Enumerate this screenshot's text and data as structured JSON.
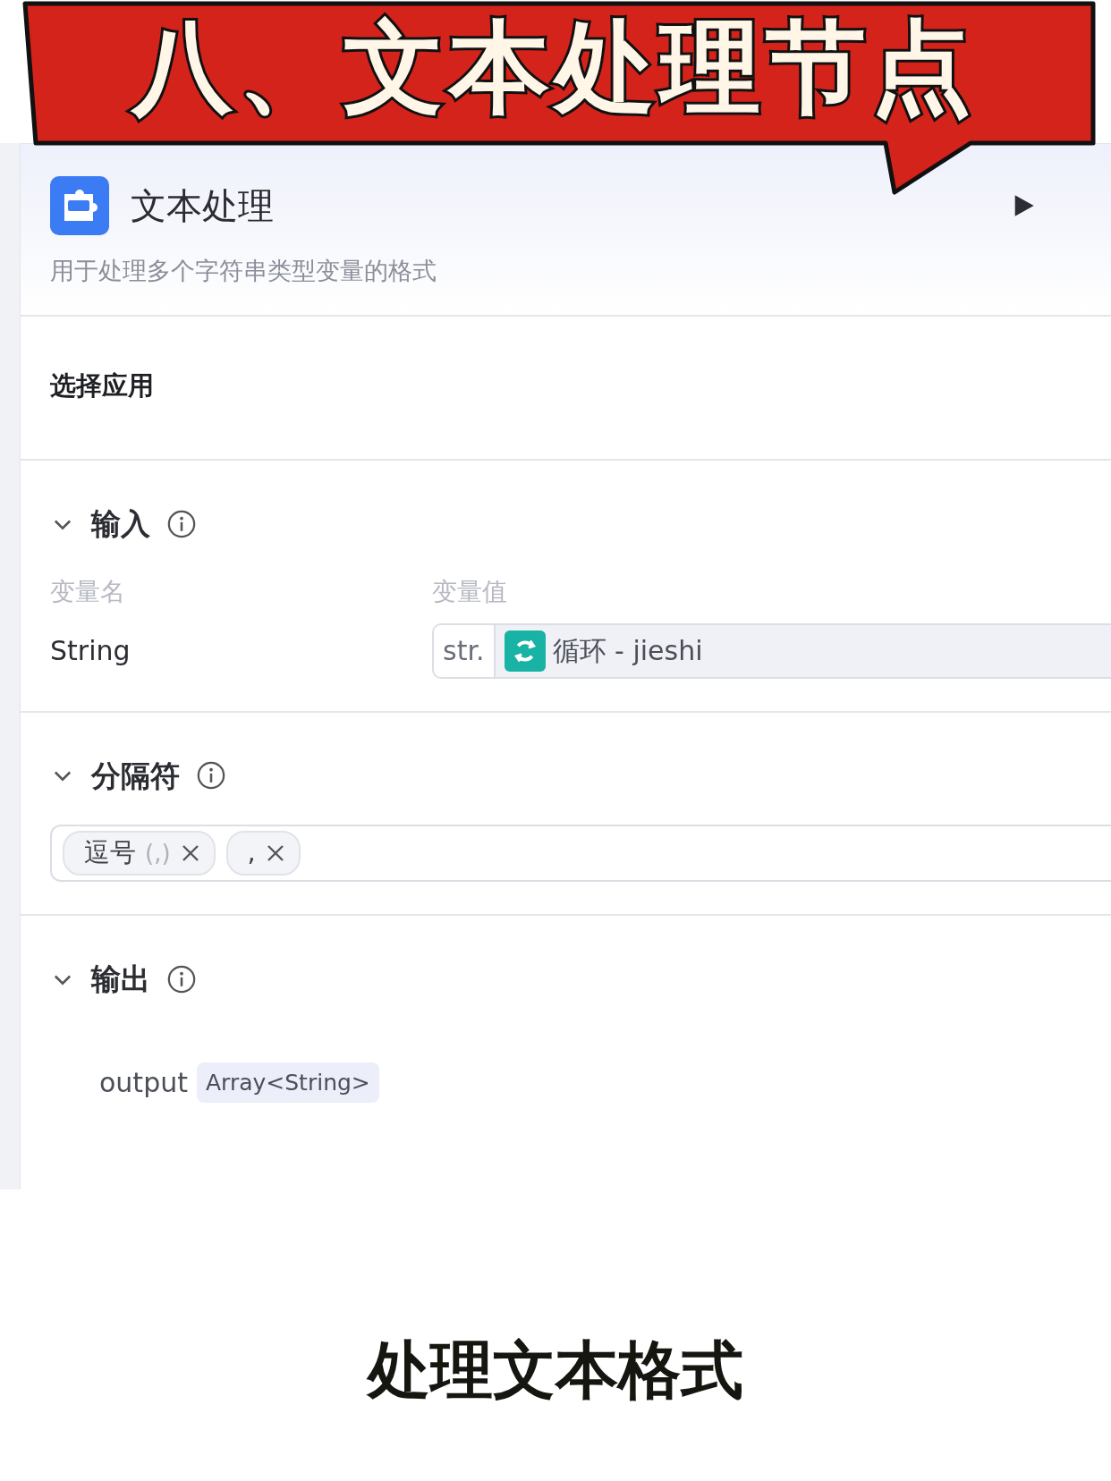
{
  "banner": {
    "title": "八、文本处理节点"
  },
  "node": {
    "title": "文本处理",
    "description": "用于处理多个字符串类型变量的格式",
    "app_label": "选择应用",
    "input": {
      "title": "输入",
      "expanded": true,
      "columns": [
        "变量名",
        "变量值"
      ],
      "rows": [
        {
          "name": "String",
          "type_tag": "str.",
          "reference": "循环 - jieshi"
        }
      ]
    },
    "separator": {
      "title": "分隔符",
      "expanded": true,
      "tags": [
        {
          "label": "逗号",
          "hint": "(,)"
        },
        {
          "label": ","
        }
      ]
    },
    "output": {
      "title": "输出",
      "expanded": true,
      "rows": [
        {
          "name": "output",
          "type": "Array<String>"
        }
      ]
    }
  },
  "caption": "处理文本格式"
}
